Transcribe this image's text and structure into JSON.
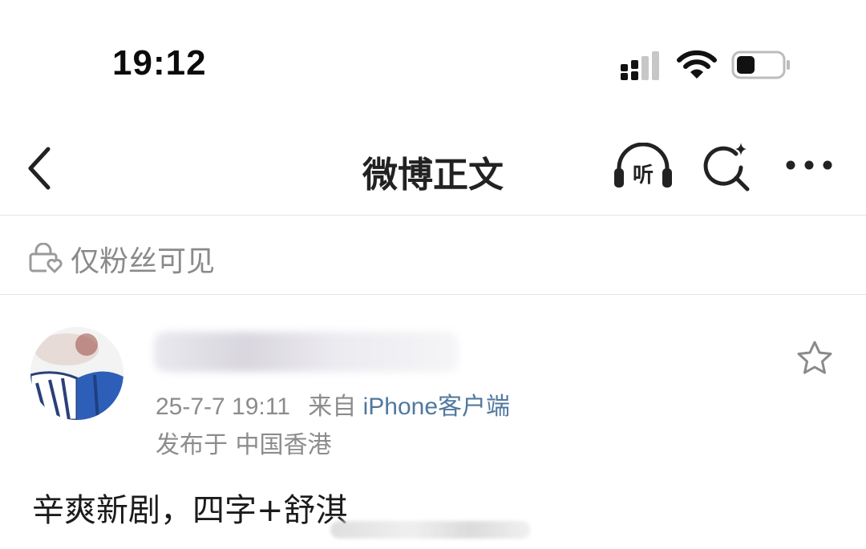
{
  "status_bar": {
    "time": "19:12"
  },
  "nav": {
    "title": "微博正文",
    "listen_label": "听",
    "icons": [
      "back-icon",
      "listen-icon",
      "search-icon",
      "more-icon"
    ]
  },
  "visibility": {
    "label": "仅粉丝可见",
    "icon": "lock-heart-icon"
  },
  "post": {
    "author_name": "",
    "date": "25-7-7 19:11",
    "source_prefix": "来自",
    "source": "iPhone客户端",
    "location": "发布于 中国香港",
    "text": "辛爽新剧，四字+舒淇"
  },
  "colors": {
    "source_link": "#51789e",
    "meta_gray": "#8c8c8c",
    "divider": "#e4e4e4"
  }
}
